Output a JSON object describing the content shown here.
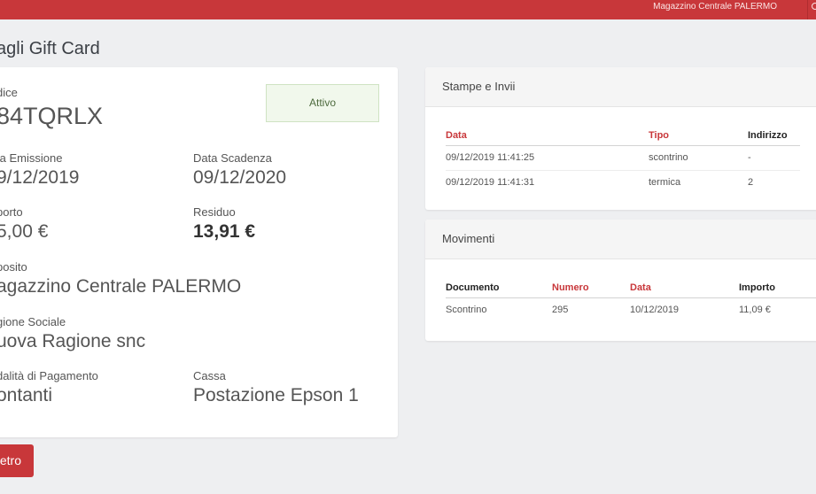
{
  "topbar": {
    "store_name": "Magazzino Centrale PALERMO"
  },
  "page": {
    "title": "agli Gift Card"
  },
  "giftcard": {
    "codice_label": "dice",
    "codice_value": "84TQRLX",
    "status": "Attivo",
    "emissione_label": "ta Emissione",
    "emissione_value": "9/12/2019",
    "scadenza_label": "Data Scadenza",
    "scadenza_value": "09/12/2020",
    "importo_label": "porto",
    "importo_value": "5,00 €",
    "residuo_label": "Residuo",
    "residuo_value": "13,91 €",
    "deposito_label": "posito",
    "deposito_value": "agazzino Centrale PALERMO",
    "ragione_label": "gione Sociale",
    "ragione_value": "uova Ragione snc",
    "pagamento_label": "dalità di Pagamento",
    "pagamento_value": "ontanti",
    "cassa_label": "Cassa",
    "cassa_value": "Postazione Epson 1"
  },
  "back_button": {
    "label": "etro"
  },
  "stampe": {
    "title": "Stampe e Invii",
    "headers": [
      "Data",
      "Tipo",
      "Indirizzo"
    ],
    "rows": [
      [
        "09/12/2019 11:41:25",
        "scontrino",
        "-"
      ],
      [
        "09/12/2019 11:41:31",
        "termica",
        "2"
      ]
    ]
  },
  "movimenti": {
    "title": "Movimenti",
    "headers": [
      "Documento",
      "Numero",
      "Data",
      "Importo"
    ],
    "rows": [
      [
        "Scontrino",
        "295",
        "10/12/2019",
        "11,09 €"
      ]
    ]
  },
  "colors": {
    "accent": "#c8373a",
    "background": "#eeeff1",
    "status_bg": "#f1f8ec"
  }
}
